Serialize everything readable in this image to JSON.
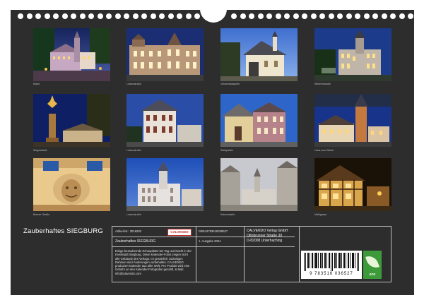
{
  "calendar_title": "Zauberhaftes SIEGBURG",
  "photos": [
    {
      "caption": "Markt"
    },
    {
      "caption": "Luisenstraße"
    },
    {
      "caption": "Johanneskapelle"
    },
    {
      "caption": "Wilhelmstraße"
    },
    {
      "caption": "Siegessäule"
    },
    {
      "caption": "Luisenstraße"
    },
    {
      "caption": "Stadtpalais"
    },
    {
      "caption": "Haus zum Winter"
    },
    {
      "caption": "Bonner Straße"
    },
    {
      "caption": "Luisenstraße"
    },
    {
      "caption": "Kaiserstraße"
    },
    {
      "caption": "Mühlgasse"
    }
  ],
  "imprint": {
    "article_label": "Artikel-Nr.: 2016282",
    "logo_text": "CALVENDO",
    "title": "Zauberhaftes SIEGBURG",
    "description": "Einige bezaubernde Schauplätze bei Tag und Nacht in der Kreisstadt Siegburg. Diese Kalender-Fotos zeigen nicht alle Gebäude des Verlags. Im gesetzlich zulässigen Rahmen sind Änderungen vorbehalten. CALVENDO produziert Kalender aus aller Welt. Pro Produkt wird eine Gebühr an den Kalender-Fotografen gezahlt. & Mail: info@calvendo.com",
    "isbn": "ISBN 9783516036527",
    "edition": "1. Ausgabe 2024",
    "publisher": [
      "CALVENDO Verlag GmbH",
      "Ottobrunner Straße 39",
      "D-82008 Unterhaching"
    ],
    "barcode_number": "9 783516 036527",
    "eco_label": "eco"
  }
}
